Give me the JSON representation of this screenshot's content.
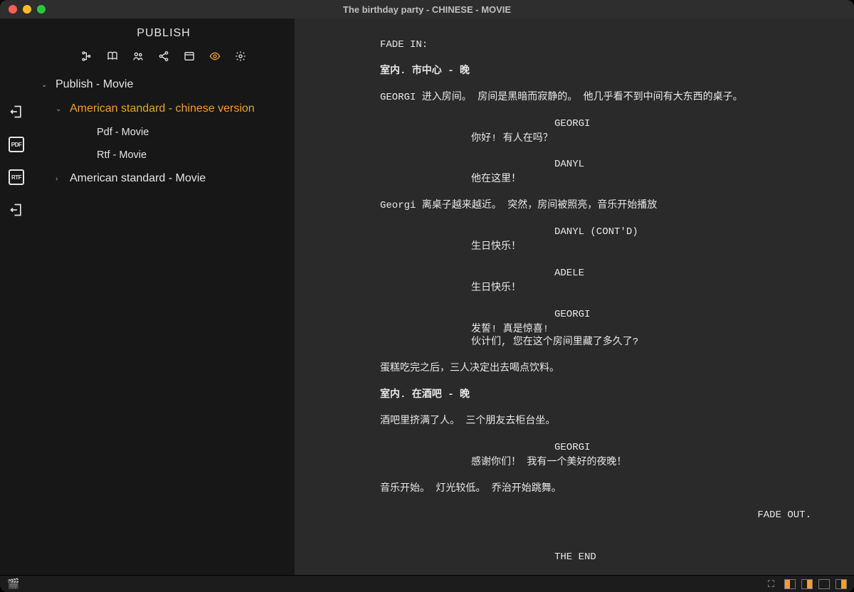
{
  "window_title": "The birthday party - CHINESE - MOVIE",
  "sidebar": {
    "title": "PUBLISH",
    "toolbar": [
      "tree",
      "book",
      "group",
      "share",
      "panel",
      "eye",
      "gear"
    ],
    "tree": [
      {
        "label": "Publish - Movie",
        "level": 0,
        "expanded": true,
        "selected": false
      },
      {
        "label": "American standard - chinese version",
        "level": 1,
        "expanded": true,
        "selected": true
      },
      {
        "label": "Pdf - Movie",
        "level": 2,
        "expanded": false,
        "selected": false
      },
      {
        "label": "Rtf - Movie",
        "level": 2,
        "expanded": false,
        "selected": false
      },
      {
        "label": "American standard - Movie",
        "level": 1,
        "expanded": false,
        "selected": false
      }
    ]
  },
  "rail": {
    "pdf_label": "PDF",
    "rtf_label": "RTF"
  },
  "script": {
    "fade_in": "FADE IN:",
    "scene1": "室内. 市中心 - 晚",
    "action1": "GEORGI 进入房间。 房间是黑暗而寂静的。 他几乎看不到中间有大东西的桌子。",
    "char1": "GEORGI",
    "dlg1": "你好!  有人在吗？",
    "char2": "DANYL",
    "dlg2": "他在这里！",
    "action2": "Georgi 离桌子越来越近。 突然，房间被照亮，音乐开始播放",
    "char3": "DANYL (CONT'D)",
    "dlg3": "生日快乐！",
    "char4": "ADELE",
    "dlg4": "生日快乐！",
    "char5": "GEORGI",
    "dlg5": "发誓!  真是惊喜!\n伙计们, 您在这个房间里藏了多久了?",
    "action3": "蛋糕吃完之后，三人决定出去喝点饮料。",
    "scene2": "室内. 在酒吧 - 晚",
    "action4": "酒吧里挤满了人。 三个朋友去柜台坐。",
    "char6": "GEORGI",
    "dlg6": "感谢你们！ 我有一个美好的夜晚！",
    "action5": "音乐开始。 灯光较低。 乔治开始跳舞。",
    "fade_out": "FADE OUT.",
    "the_end": "THE END"
  }
}
